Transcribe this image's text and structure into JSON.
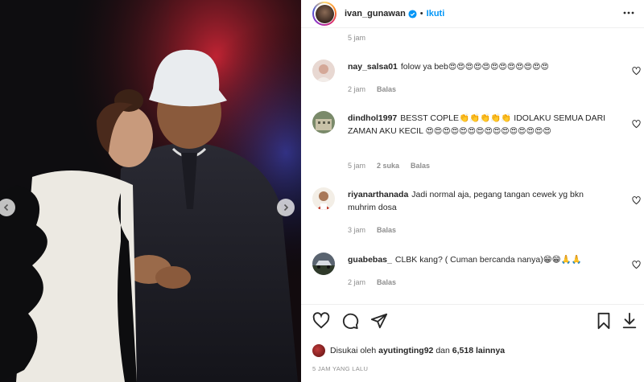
{
  "post": {
    "username": "ivan_gunawan",
    "follow_label": "Ikuti",
    "top_time": "5 jam"
  },
  "comments": [
    {
      "user": "nay_salsa01",
      "text": "folow ya beb",
      "emoji": "😍😍😍😍😍😍😍😍😍😍😍😍",
      "time": "2 jam",
      "likes": "",
      "reply": "Balas"
    },
    {
      "user": "dindhol1997",
      "text": "BESST COPLE👏👏👏👏👏 IDOLAKU SEMUA DARI ZAMAN AKU KECIL",
      "emoji": "😍😍😍😍😍😍😍😍😍😍😍😍😍😍😍",
      "time": "5 jam",
      "likes": "2 suka",
      "reply": "Balas"
    },
    {
      "user": "riyanarthanada",
      "text": "Jadi normal aja, pegang tangan cewek yg bkn muhrim dosa",
      "emoji": "",
      "time": "3 jam",
      "likes": "",
      "reply": "Balas"
    },
    {
      "user": "guabebas_",
      "text": "CLBK kang? ( Cuman bercanda nanya)😁😁🙏🙏",
      "emoji": "",
      "time": "2 jam",
      "likes": "",
      "reply": "Balas"
    }
  ],
  "likes": {
    "prefix": "Disukai oleh",
    "user": "ayutingting92",
    "connector": "dan",
    "count": "6,518 lainnya"
  },
  "post_time": "5 JAM YANG LALU",
  "icons": [
    "verified-badge-icon",
    "more-options-icon",
    "heart-icon",
    "comment-icon",
    "share-icon",
    "bookmark-icon",
    "download-icon",
    "chevron-left-icon",
    "chevron-right-icon"
  ],
  "colors": {
    "accent": "#0095f6",
    "text": "#262626",
    "muted": "#8e8e8e"
  }
}
